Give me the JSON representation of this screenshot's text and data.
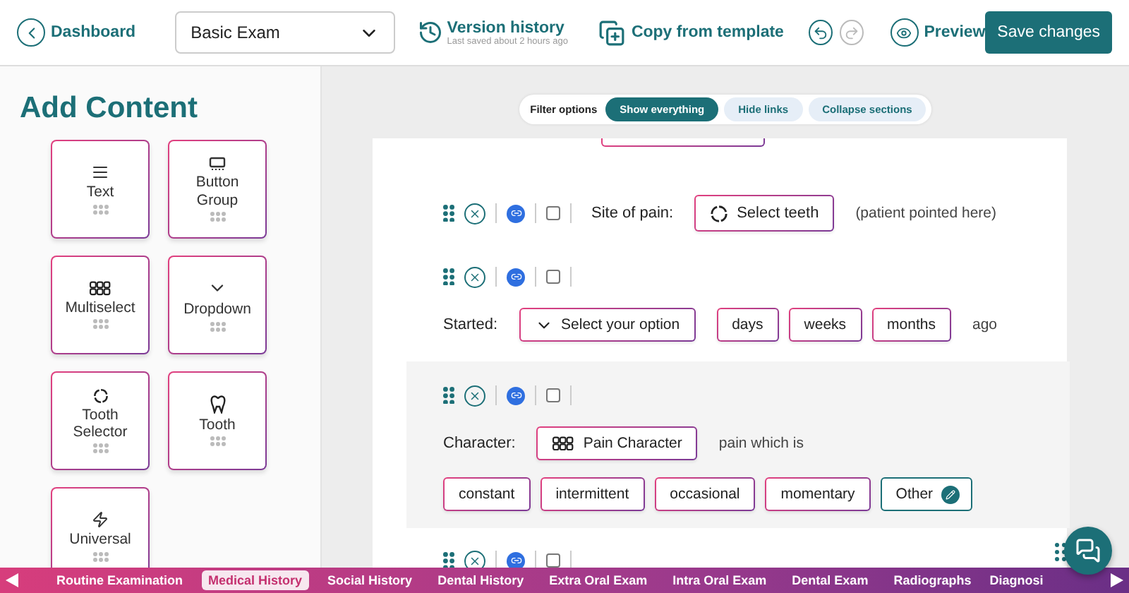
{
  "header": {
    "back_link": "Dashboard",
    "exam_select": {
      "value": "Basic Exam"
    },
    "version_history": {
      "label": "Version history",
      "subtitle": "Last saved about 2 hours ago"
    },
    "copy_template": "Copy from template",
    "undo": {
      "disabled": false
    },
    "redo": {
      "disabled": true
    },
    "preview": "Preview",
    "save": "Save changes"
  },
  "sidebar": {
    "title": "Add Content",
    "blocks": [
      {
        "kind": "text",
        "label": "Text"
      },
      {
        "kind": "button_group",
        "label": "Button Group"
      },
      {
        "kind": "multiselect",
        "label": "Multiselect"
      },
      {
        "kind": "dropdown",
        "label": "Dropdown"
      },
      {
        "kind": "tooth_selector",
        "label": "Tooth Selector"
      },
      {
        "kind": "tooth",
        "label": "Tooth"
      },
      {
        "kind": "universal",
        "label": "Universal"
      }
    ]
  },
  "filter": {
    "label": "Filter options",
    "options": [
      {
        "label": "Show everything",
        "selected": true
      },
      {
        "label": "Hide links",
        "selected": false
      },
      {
        "label": "Collapse sections",
        "selected": false
      }
    ]
  },
  "rows": [
    {
      "highlighted": false,
      "checked": false,
      "kind": "inline",
      "lines": [
        [
          {
            "kind": "label",
            "text": "Site of pain:"
          },
          {
            "kind": "tooth_select",
            "text": "Select teeth"
          },
          {
            "kind": "note",
            "text": "(patient pointed here)"
          }
        ]
      ]
    },
    {
      "highlighted": false,
      "checked": false,
      "kind": "stacked",
      "lines": [
        [
          {
            "kind": "label",
            "text": "Started:"
          },
          {
            "kind": "dropdown",
            "text": "Select your option"
          },
          {
            "kind": "option",
            "text": "days"
          },
          {
            "kind": "option",
            "text": "weeks"
          },
          {
            "kind": "option",
            "text": "months"
          },
          {
            "kind": "note",
            "text": "ago"
          }
        ]
      ]
    },
    {
      "highlighted": true,
      "checked": false,
      "kind": "stacked",
      "lines": [
        [
          {
            "kind": "label",
            "text": "Character:"
          },
          {
            "kind": "multiselect",
            "text": "Pain Character"
          },
          {
            "kind": "note",
            "text": "pain which is"
          }
        ],
        [
          {
            "kind": "option",
            "text": "constant"
          },
          {
            "kind": "option",
            "text": "intermittent"
          },
          {
            "kind": "option",
            "text": "occasional"
          },
          {
            "kind": "option",
            "text": "momentary"
          },
          {
            "kind": "other",
            "text": "Other"
          }
        ]
      ]
    },
    {
      "highlighted": false,
      "checked": false,
      "kind": "stacked",
      "lines": []
    }
  ],
  "sections": [
    {
      "label": "Routine Examination",
      "selected": false
    },
    {
      "label": "Medical History",
      "selected": true
    },
    {
      "label": "Social History",
      "selected": false
    },
    {
      "label": "Dental History",
      "selected": false
    },
    {
      "label": "Extra Oral Exam",
      "selected": false
    },
    {
      "label": "Intra Oral Exam",
      "selected": false
    },
    {
      "label": "Dental Exam",
      "selected": false
    },
    {
      "label": "Radiographs",
      "selected": false
    },
    {
      "label": "Diagnosi",
      "selected": false
    }
  ]
}
